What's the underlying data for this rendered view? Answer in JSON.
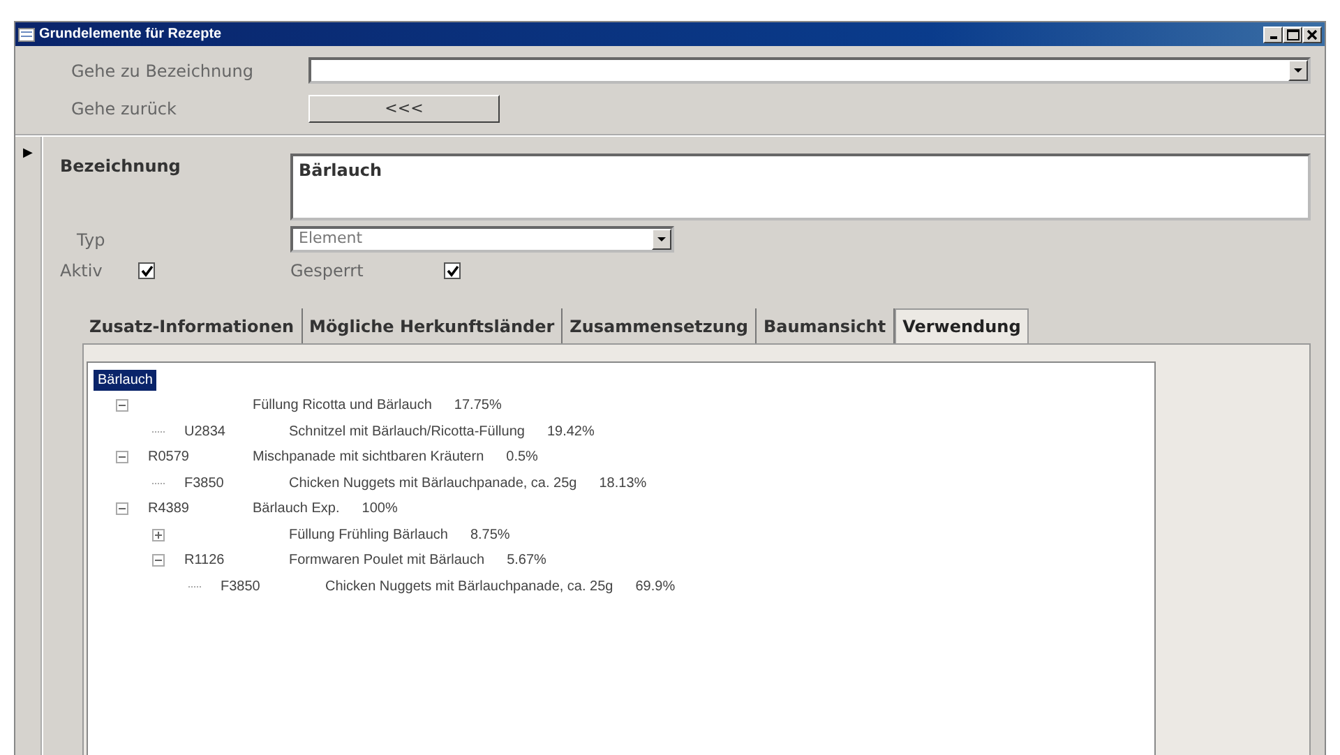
{
  "window": {
    "title": "Grundelemente für Rezepte"
  },
  "goto": {
    "label": "Gehe zu Bezeichnung"
  },
  "back": {
    "label": "Gehe zurück",
    "button": "<<<"
  },
  "record_marker": "▶",
  "name_field": {
    "label": "Bezeichnung",
    "value": "Bärlauch"
  },
  "type_field": {
    "label": "Typ",
    "value": "Element"
  },
  "checks": [
    {
      "label": "Aktiv",
      "checked": true
    },
    {
      "label": "Gesperrt",
      "checked": true
    }
  ],
  "tabs": [
    {
      "label": "Zusatz-Informationen",
      "selected": false
    },
    {
      "label": "Mögliche Herkunftsländer",
      "selected": false
    },
    {
      "label": "Zusammensetzung",
      "selected": false
    },
    {
      "label": "Baumansicht",
      "selected": false
    },
    {
      "label": "Verwendung",
      "selected": true
    }
  ],
  "tree": {
    "label": "Bärlauch",
    "selected": true,
    "children": [
      {
        "name": "Füllung Ricotta und Bärlauch",
        "share": "17.75%",
        "expanded": true,
        "children": [
          {
            "code": "U2834",
            "name": "Schnitzel mit Bärlauch/Ricotta-Füllung",
            "share": "19.42%"
          }
        ]
      },
      {
        "code": "R0579",
        "name": "Mischpanade mit sichtbaren Kräutern",
        "share": "0.5%",
        "expanded": true,
        "children": [
          {
            "code": "F3850",
            "name": "Chicken Nuggets mit Bärlauchpanade, ca. 25g",
            "share": "18.13%"
          }
        ]
      },
      {
        "code": "R4389",
        "name": "Bärlauch Exp.",
        "share": "100%",
        "expanded": true,
        "children": [
          {
            "name": "Füllung Frühling Bärlauch",
            "share": "8.75%",
            "expanded": false
          },
          {
            "code": "R1126",
            "name": "Formwaren Poulet mit Bärlauch",
            "share": "5.67%",
            "expanded": true,
            "children": [
              {
                "code": "F3850",
                "name": "Chicken Nuggets mit Bärlauchpanade, ca. 25g",
                "share": "69.9%"
              }
            ]
          }
        ]
      }
    ]
  }
}
